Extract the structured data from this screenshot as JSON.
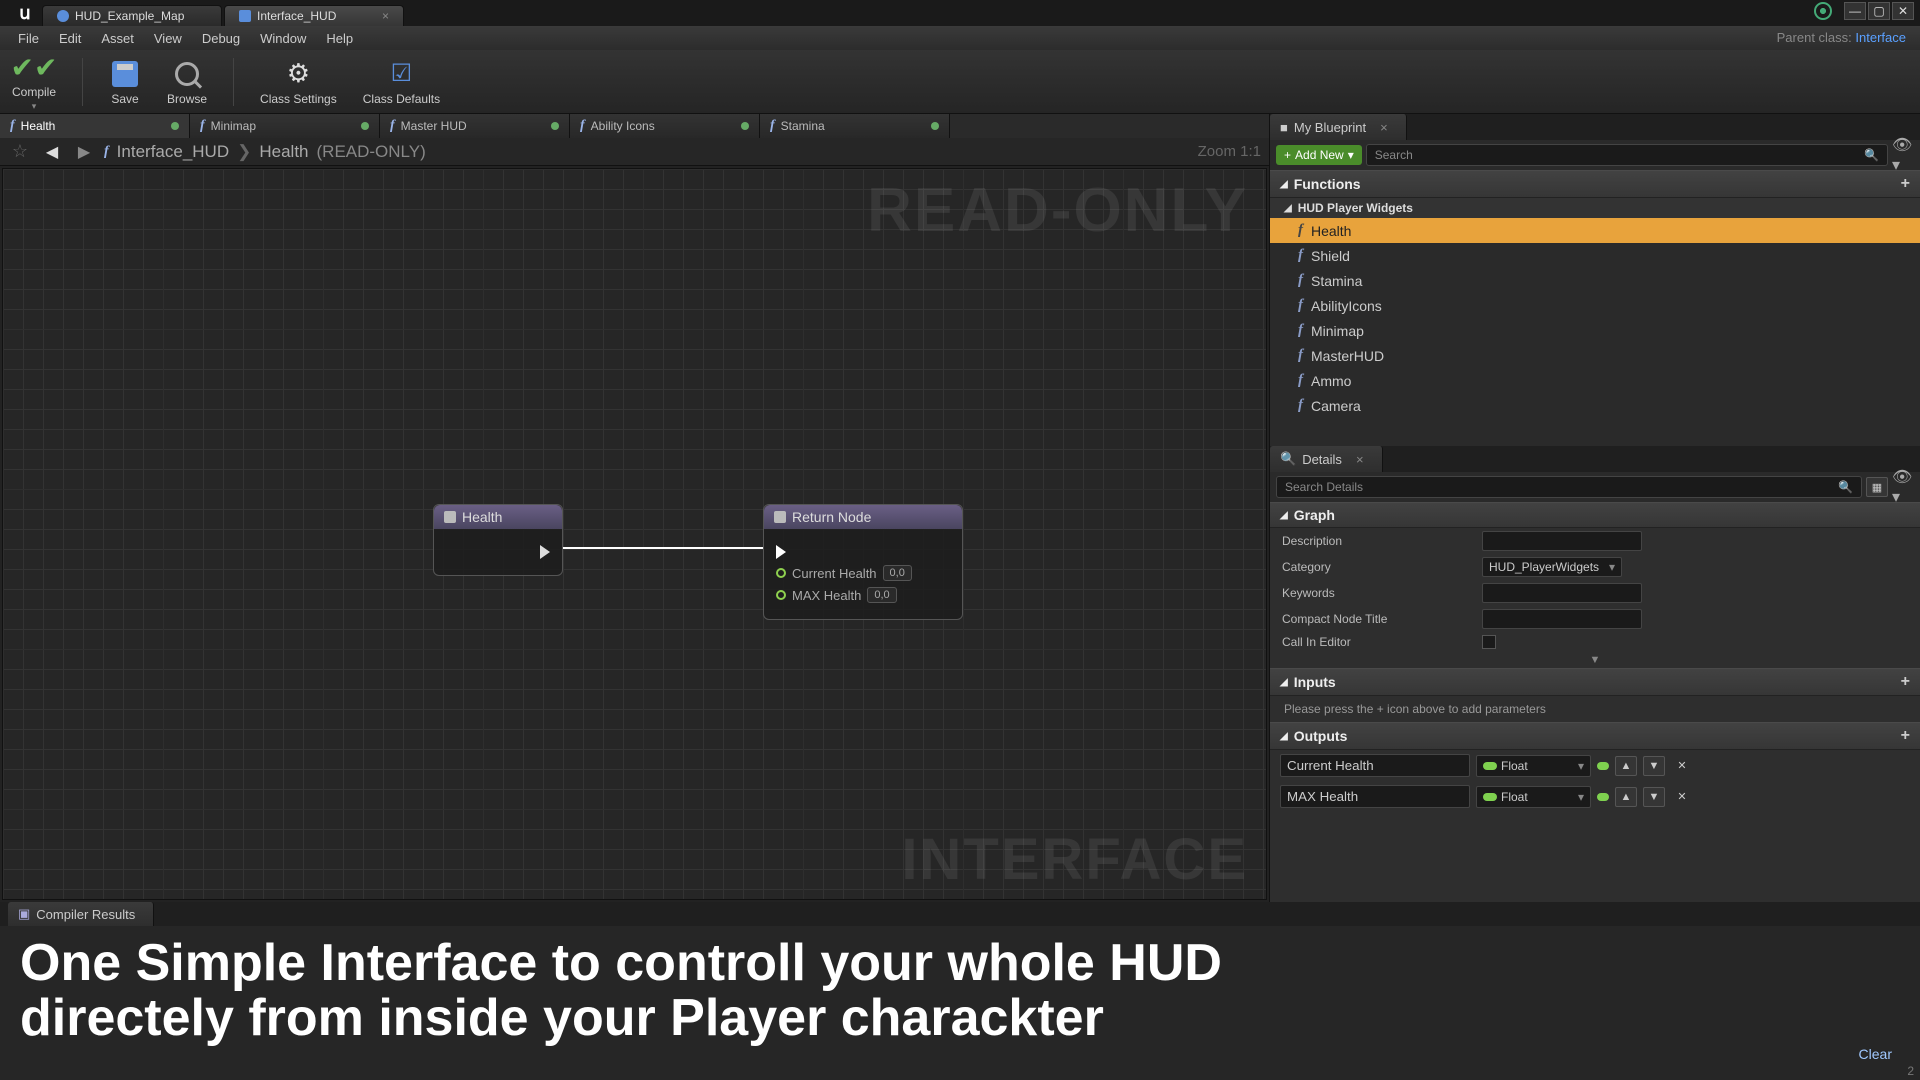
{
  "doc_tabs": [
    {
      "label": "HUD_Example_Map"
    },
    {
      "label": "Interface_HUD"
    }
  ],
  "menus": [
    "File",
    "Edit",
    "Asset",
    "View",
    "Debug",
    "Window",
    "Help"
  ],
  "parent_class": {
    "label": "Parent class:",
    "value": "Interface"
  },
  "toolbar": {
    "compile": "Compile",
    "save": "Save",
    "browse": "Browse",
    "class_settings": "Class Settings",
    "class_defaults": "Class Defaults"
  },
  "fn_tabs": [
    "Health",
    "Minimap",
    "Master HUD",
    "Ability Icons",
    "Stamina"
  ],
  "breadcrumb": {
    "root": "Interface_HUD",
    "leaf": "Health",
    "suffix": "(READ-ONLY)"
  },
  "zoom": "Zoom 1:1",
  "watermarks": {
    "top": "READ-ONLY",
    "bottom": "INTERFACE"
  },
  "nodes": {
    "entry": {
      "title": "Health"
    },
    "return": {
      "title": "Return Node",
      "pins": [
        {
          "name": "Current Health",
          "value": "0,0"
        },
        {
          "name": "MAX Health",
          "value": "0,0"
        }
      ]
    }
  },
  "my_blueprint": {
    "title": "My Blueprint",
    "add_new": "Add New",
    "search_placeholder": "Search",
    "functions_header": "Functions",
    "group": "HUD Player Widgets",
    "items": [
      "Health",
      "Shield",
      "Stamina",
      "AbilityIcons",
      "Minimap",
      "MasterHUD",
      "Ammo",
      "Camera"
    ]
  },
  "details": {
    "title": "Details",
    "search_placeholder": "Search Details",
    "graph_header": "Graph",
    "rows": {
      "description": {
        "label": "Description",
        "value": ""
      },
      "category": {
        "label": "Category",
        "value": "HUD_PlayerWidgets"
      },
      "keywords": {
        "label": "Keywords",
        "value": ""
      },
      "compact": {
        "label": "Compact Node Title",
        "value": ""
      },
      "call_in_editor": {
        "label": "Call In Editor"
      }
    },
    "inputs": {
      "header": "Inputs",
      "help": "Please press the + icon above to add parameters"
    },
    "outputs": {
      "header": "Outputs",
      "params": [
        {
          "name": "Current Health",
          "type": "Float"
        },
        {
          "name": "MAX Health",
          "type": "Float"
        }
      ]
    }
  },
  "compiler": {
    "title": "Compiler Results",
    "clear": "Clear"
  },
  "overlay_text_line1": "One Simple Interface to controll your whole HUD",
  "overlay_text_line2": "directely from inside your Player charackter",
  "page_number": "2"
}
